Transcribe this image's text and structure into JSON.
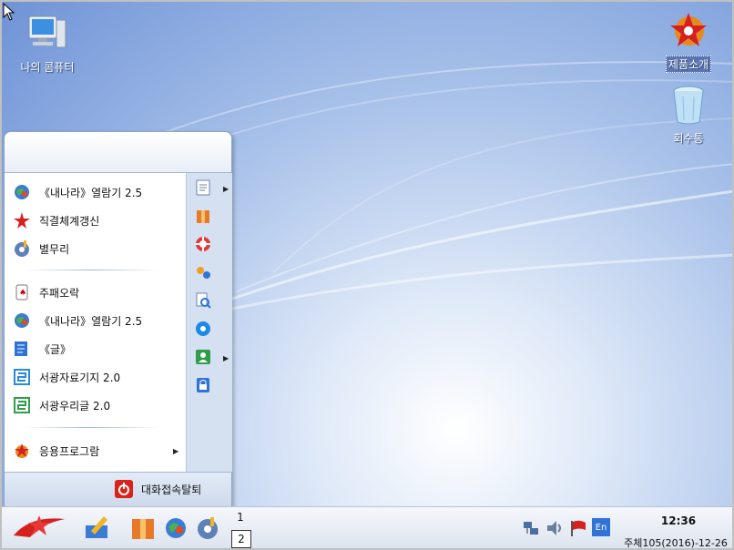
{
  "desktop": {
    "icons": [
      {
        "label": "나의 콤퓨터"
      },
      {
        "label": "제품소개"
      },
      {
        "label": "회수통"
      }
    ]
  },
  "start_menu": {
    "items": [
      {
        "label": "《내나라》열람기 2.5",
        "icon": "globe-browser-icon"
      },
      {
        "label": "직결체계갱신",
        "icon": "red-star-update-icon"
      },
      {
        "label": "별무리",
        "icon": "music-player-icon"
      },
      {
        "label": "주패오락",
        "icon": "card-game-icon"
      },
      {
        "label": "《내나라》열람기 2.5",
        "icon": "globe-browser-icon"
      },
      {
        "label": "《글》",
        "icon": "word-processor-icon"
      },
      {
        "label": "서광자료기지 2.0",
        "icon": "database-icon"
      },
      {
        "label": "서광우리글 2.0",
        "icon": "text-editor-icon"
      },
      {
        "label": "응용프로그람",
        "icon": "applications-icon"
      }
    ],
    "right_icons": [
      "documents-icon",
      "package-icon",
      "help-lifebuoy-icon",
      "tools-icon",
      "search-icon",
      "settings-gear-icon",
      "user-icon",
      "lock-icon"
    ],
    "logout_label": "대화접속탈퇴"
  },
  "taskbar": {
    "launchers": [
      "red-star-logo-icon",
      "edit-tool-icon",
      "package-icon",
      "globe-browser-icon",
      "music-player-icon"
    ],
    "workspaces": [
      "1",
      "2"
    ],
    "tray": [
      "network-icon",
      "volume-icon",
      "flag-icon",
      "input-method-icon"
    ],
    "input_method": "En",
    "clock_time": "12:36",
    "clock_date": "주체105(2016)-12-26"
  },
  "colors": {
    "desktop_blue": "#7a9bd8",
    "menu_side": "#d5e0f1",
    "logout_red": "#d9231c"
  }
}
